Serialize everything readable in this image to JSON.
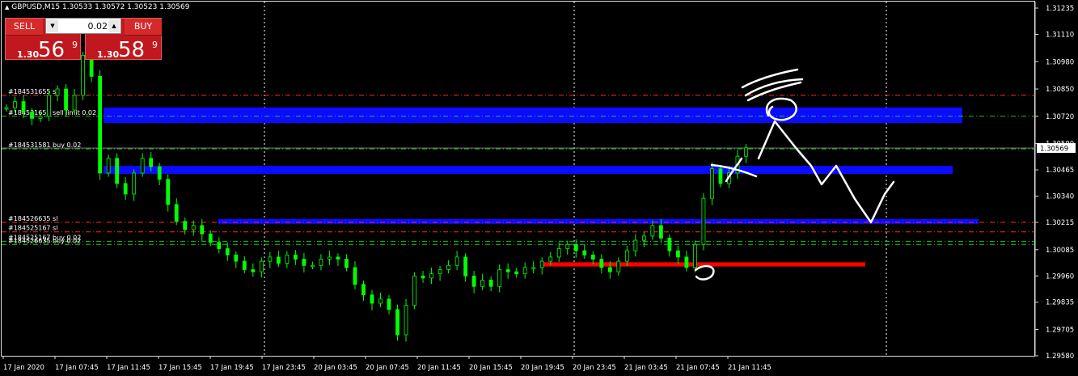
{
  "header": {
    "symbol_info": "GBPUSD,M15  1.30533 1.30572 1.30523 1.30569",
    "collapse_icon": "triangle-up-icon"
  },
  "trade_panel": {
    "sell_label": "SELL",
    "buy_label": "BUY",
    "lot_value": "0.02",
    "sell_price": {
      "prefix": "1.30",
      "big": "56",
      "sup": "9"
    },
    "buy_price": {
      "prefix": "1.30",
      "big": "58",
      "sup": "9"
    },
    "colors": {
      "panel": "#c0181e",
      "button": "#d62a2a"
    }
  },
  "chart_data": {
    "type": "candlestick",
    "candle_color": "#00ff00",
    "price_axis": [
      "1.31235",
      "1.31110",
      "1.30980",
      "1.30850",
      "1.30720",
      "1.30590",
      "1.30465",
      "1.30340",
      "1.30215",
      "1.30085",
      "1.29960",
      "1.29835",
      "1.29705",
      "1.29580"
    ],
    "current_price": "1.30569",
    "time_axis": [
      "17 Jan 2020",
      "17 Jan 07:45",
      "17 Jan 11:45",
      "17 Jan 15:45",
      "17 Jan 19:45",
      "17 Jan 23:45",
      "20 Jan 03:45",
      "20 Jan 07:45",
      "20 Jan 11:45",
      "20 Jan 15:45",
      "20 Jan 19:45",
      "20 Jan 23:45",
      "21 Jan 03:45",
      "21 Jan 07:45",
      "21 Jan 11:45"
    ],
    "order_lines": [
      {
        "label": "#184531655 sl",
        "price": 1.3082,
        "color": "#ff2a2a"
      },
      {
        "label": "#184531655 sell limit 0.02",
        "price": 1.3072,
        "color": "#18c818"
      },
      {
        "label": "#184531581 buy 0.02",
        "price": 1.30565,
        "color": "#18c818"
      },
      {
        "label": "#184526635 sl",
        "price": 1.30215,
        "color": "#ff2a2a"
      },
      {
        "label": "#184525167 sl",
        "price": 1.3017,
        "color": "#ff2a2a"
      },
      {
        "label": "#184525167 buy 0.02",
        "price": 1.30125,
        "color": "#18c818"
      },
      {
        "label": "#184526635 buy 0.02",
        "price": 1.3011,
        "color": "#18c818"
      }
    ],
    "zones": [
      {
        "price_top": 1.30762,
        "price_bottom": 1.30688,
        "color": "#0b0bff"
      },
      {
        "price_top": 1.30484,
        "price_bottom": 1.30446,
        "color": "#0b0bff"
      },
      {
        "price_top": 1.30231,
        "price_bottom": 1.30208,
        "color": "#0b0bff"
      },
      {
        "price_top": 1.30025,
        "price_bottom": 1.30005,
        "color": "#ff0000"
      }
    ],
    "close_prices": [
      1.3076,
      1.3079,
      1.3074,
      1.3071,
      1.3072,
      1.3082,
      1.3085,
      1.3075,
      1.3082,
      1.3101,
      1.3091,
      1.3045,
      1.3052,
      1.304,
      1.3035,
      1.3045,
      1.3052,
      1.3048,
      1.3042,
      1.303,
      1.3022,
      1.3018,
      1.302,
      1.3016,
      1.3012,
      1.3009,
      1.3006,
      1.3003,
      1.2999,
      1.2998,
      1.3003,
      1.3005,
      1.3002,
      1.3006,
      1.3004,
      1.3001,
      1.3001,
      1.3004,
      1.3005,
      1.3004,
      1.3,
      1.2992,
      1.2987,
      1.2983,
      1.2985,
      1.298,
      1.2968,
      1.2982,
      1.2996,
      1.2995,
      1.2997,
      1.2999,
      1.3001,
      1.3005,
      1.2996,
      1.2991,
      1.2994,
      1.2991,
      1.2999,
      1.2998,
      1.2997,
      1.3,
      1.3,
      1.3003,
      1.3005,
      1.3009,
      1.3011,
      1.3008,
      1.3006,
      1.3004,
      1.3,
      1.2998,
      1.3003,
      1.3008,
      1.3013,
      1.3015,
      1.302,
      1.3014,
      1.3008,
      1.3005,
      1.3,
      1.3011,
      1.3033,
      1.3047,
      1.304,
      1.3045,
      1.3053,
      1.3057
    ]
  }
}
